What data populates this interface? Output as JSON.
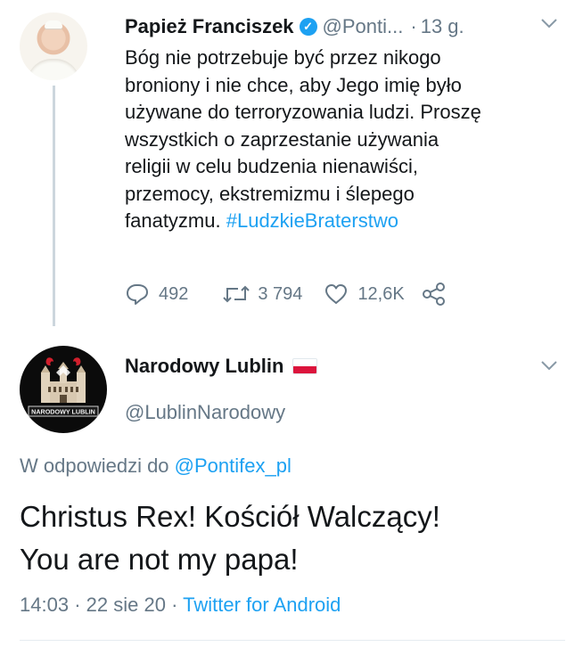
{
  "tweet1": {
    "author_name": "Papież Franciszek",
    "author_handle": "@Ponti...",
    "separator": "·",
    "time": "13 g.",
    "text_line1": "Bóg nie potrzebuje być przez nikogo",
    "text_line2": "broniony i nie chce, aby Jego imię było",
    "text_line3": "używane do terroryzowania ludzi. Proszę",
    "text_line4": "wszystkich o zaprzestanie używania",
    "text_line5": "religii w celu budzenia nienawiści,",
    "text_line6": "przemocy, ekstremizmu i ślepego",
    "text_line7_prefix": "fanatyzmu.",
    "hashtag": "#LudzkieBraterstwo",
    "reply_count": "492",
    "retweet_count": "3 794",
    "like_count": "12,6K"
  },
  "tweet2": {
    "author_name": "Narodowy Lublin",
    "author_handle": "@LublinNarodowy",
    "avatar_text": "NARODOWY LUBLIN",
    "reply_prefix": "W odpowiedzi do",
    "reply_mention": "@Pontifex_pl",
    "text_line1": "Christus Rex! Kościół Walczący!",
    "text_line2": "You are not my papa!",
    "time": "14:03",
    "date": "22 sie 20",
    "separator": "·",
    "client": "Twitter for Android"
  },
  "icons": {
    "verified": "verified-badge-icon",
    "more": "chevron-down-icon",
    "reply": "reply-bubble-icon",
    "retweet": "retweet-icon",
    "like": "heart-icon",
    "share": "share-icon"
  },
  "colors": {
    "accent": "#1da1f2",
    "text": "#14171a",
    "secondary": "#657786",
    "flag_red": "#dc143c"
  }
}
